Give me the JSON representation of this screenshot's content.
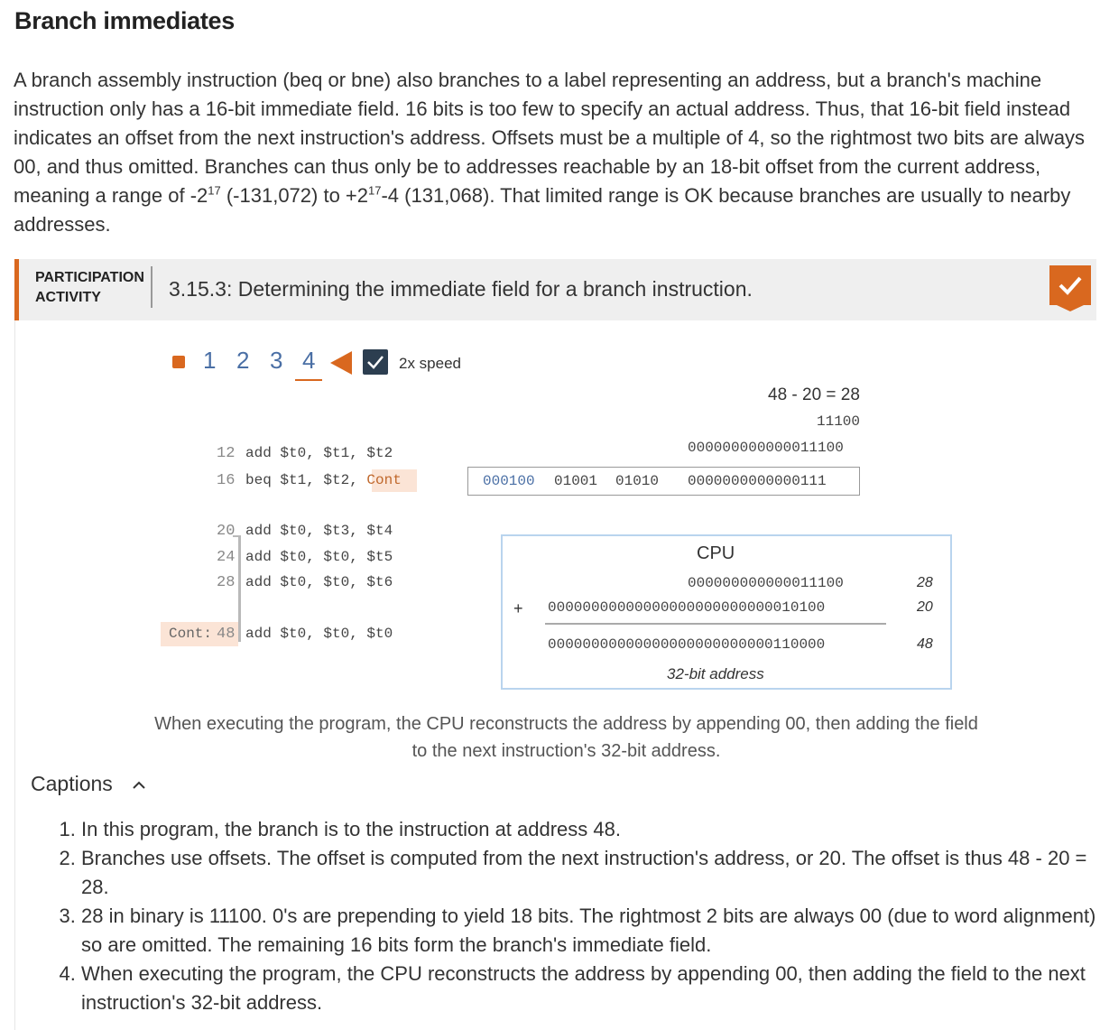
{
  "section": {
    "title": "Branch immediates",
    "intro_part1": "A branch assembly instruction (beq or bne) also branches to a label representing an address, but a branch's machine instruction only has a 16-bit immediate field. 16 bits is too few to specify an actual address. Thus, that 16-bit field instead indicates an offset from the next instruction's address. Offsets must be a multiple of 4, so the rightmost two bits are always 00, and thus omitted. Branches can thus only be to addresses reachable by an 18-bit offset from the current address, meaning a range of -2",
    "exp1": "17",
    "intro_part2": " (-131,072) to +2",
    "exp2": "17",
    "intro_part3": "-4 (131,068). That limited range is OK because branches are usually to nearby addresses."
  },
  "activity": {
    "label_line1": "PARTICIPATION",
    "label_line2": "ACTIVITY",
    "title": "3.15.3: Determining the immediate field for a branch instruction.",
    "completed_icon": "check-icon",
    "steps": [
      "1",
      "2",
      "3",
      "4"
    ],
    "current_step": "4",
    "speed_label": "2x speed",
    "speed_checked": true,
    "accent_color": "#d9681f"
  },
  "program": {
    "lines": [
      {
        "addr": "12",
        "code": "add $t0, $t1, $t2"
      },
      {
        "addr": "16",
        "code": "beq $t1, $t2, ",
        "label_ref": "Cont"
      },
      {
        "addr": "20",
        "code": "add $t0, $t3, $t4"
      },
      {
        "addr": "24",
        "code": "add $t0, $t0, $t5"
      },
      {
        "addr": "28",
        "code": "add $t0, $t0, $t6"
      },
      {
        "label": "Cont:",
        "addr": "48",
        "code": "add $t0, $t0, $t0"
      }
    ]
  },
  "offset_calc": {
    "equation": "48 - 20 = 28",
    "binary": "11100",
    "binary18": "000000000000011100"
  },
  "encoding": {
    "opcode": "000100",
    "rs": "01001",
    "rt": "01010",
    "imm": "0000000000000111"
  },
  "cpu": {
    "title": "CPU",
    "row1_bin": "000000000000011100",
    "row1_dec": "28",
    "plus": "+",
    "row2_bin": "00000000000000000000000000010100",
    "row2_dec": "20",
    "result_bin": "00000000000000000000000000110000",
    "result_dec": "48",
    "footer": "32-bit address"
  },
  "animation_caption": "When executing the program, the CPU reconstructs the address by appending 00, then adding the field to the next instruction's 32-bit address.",
  "captions": {
    "toggle_label": "Captions",
    "items": [
      "In this program, the branch is to the instruction at address 48.",
      "Branches use offsets. The offset is computed from the next instruction's address, or 20. The offset is thus 48 - 20 = 28.",
      "28 in binary is 11100. 0's are prepending to yield 18 bits. The rightmost 2 bits are always 00 (due to word alignment) so are omitted. The remaining 16 bits form the branch's immediate field.",
      "When executing the program, the CPU reconstructs the address by appending 00, then adding the field to the next instruction's 32-bit address."
    ]
  }
}
